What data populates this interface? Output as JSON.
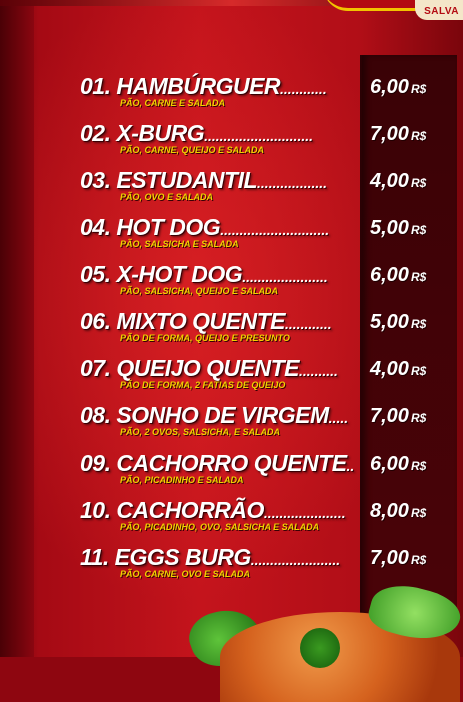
{
  "logo": {
    "text": "SALVA"
  },
  "currency": "R$",
  "items": [
    {
      "name": "01. HAMBÚRGUER",
      "dots": "............",
      "desc": "PÃO, CARNE E SALADA",
      "price": "6,00"
    },
    {
      "name": "02. X-BURG",
      "dots": "............................",
      "desc": "PÃO, CARNE, QUEIJO E SALADA",
      "price": "7,00"
    },
    {
      "name": "03. ESTUDANTIL",
      "dots": "..................",
      "desc": "PÃO, OVO E SALADA",
      "price": "4,00"
    },
    {
      "name": "04. HOT DOG",
      "dots": "............................",
      "desc": "PÃO, SALSICHA E SALADA",
      "price": "5,00"
    },
    {
      "name": "05. X-HOT DOG",
      "dots": "......................",
      "desc": "PÃO, SALSICHA, QUEIJO E SALADA",
      "price": "6,00"
    },
    {
      "name": "06. MIXTO QUENTE",
      "dots": "............",
      "desc": "PÃO DE FORMA, QUEIJO E PRESUNTO",
      "price": "5,00"
    },
    {
      "name": "07. QUEIJO QUENTE",
      "dots": "..........",
      "desc": "PÃO DE FORMA, 2 FATIAS DE QUEIJO",
      "price": "4,00"
    },
    {
      "name": "08. SONHO DE VIRGEM",
      "dots": ".....",
      "desc": "PÃO, 2 OVOS, SALSICHA, E SALADA",
      "price": "7,00"
    },
    {
      "name": "09. CACHORRO QUENTE",
      "dots": "..",
      "desc": "PÃO, PICADINHO E SALADA",
      "price": "6,00"
    },
    {
      "name": "10. CACHORRÃO",
      "dots": ".....................",
      "desc": "PÃO, PICADINHO, OVO, SALSICHA E SALADA",
      "price": "8,00"
    },
    {
      "name": "11. EGGS BURG",
      "dots": ".......................",
      "desc": "PÃO, CARNE, OVO E SALADA",
      "price": "7,00"
    }
  ]
}
